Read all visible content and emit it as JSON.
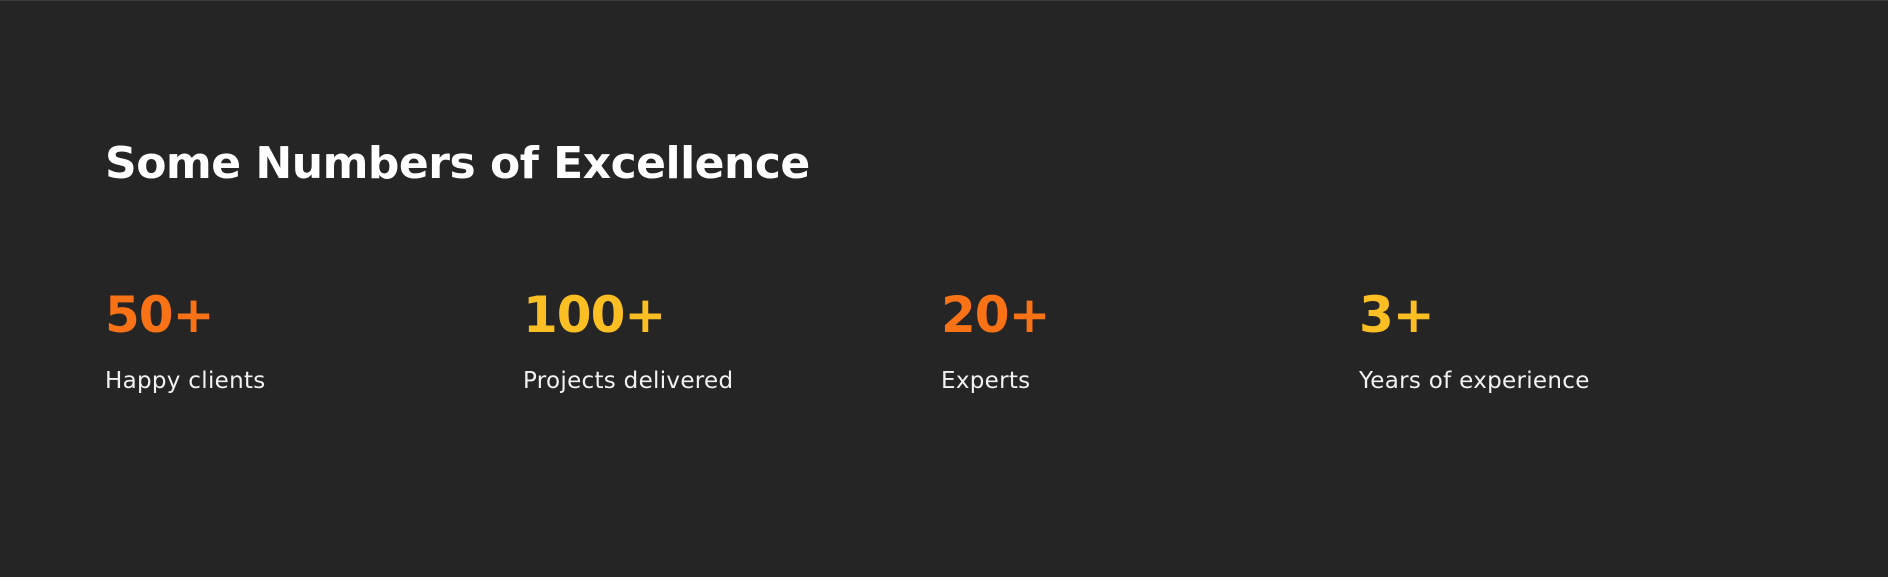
{
  "section": {
    "title": "Some Numbers of Excellence",
    "background_color": "#252525",
    "stats": [
      {
        "value": "50+",
        "label": "Happy clients",
        "color": "#f97316"
      },
      {
        "value": "100+",
        "label": "Projects delivered",
        "color": "#fbbf24"
      },
      {
        "value": "20+",
        "label": "Experts",
        "color": "#f97316"
      },
      {
        "value": "3+",
        "label": "Years of experience",
        "color": "#fbbf24"
      }
    ]
  }
}
